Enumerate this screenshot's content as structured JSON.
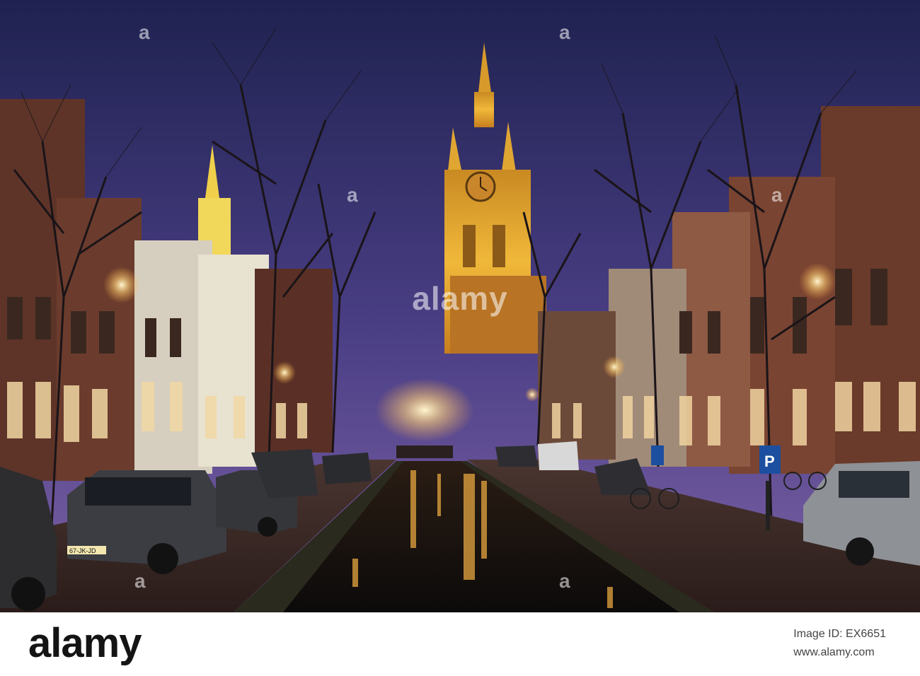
{
  "watermark": {
    "center_text": "alamy",
    "mark_glyph": "a"
  },
  "footer": {
    "logo": "alamy",
    "image_id_line": "Image ID: EX6651",
    "url": "www.alamy.com"
  },
  "scene": {
    "description_icon": "night-canal-church-photo",
    "plate_text": "67-JK-JD",
    "parking_sign_text": "P",
    "colors": {
      "sky_top": "#2a2a5e",
      "sky_bottom": "#6c5a9e",
      "tower": "#e8b534",
      "brick": "#7a3f2c",
      "water": "#1b1410"
    }
  }
}
